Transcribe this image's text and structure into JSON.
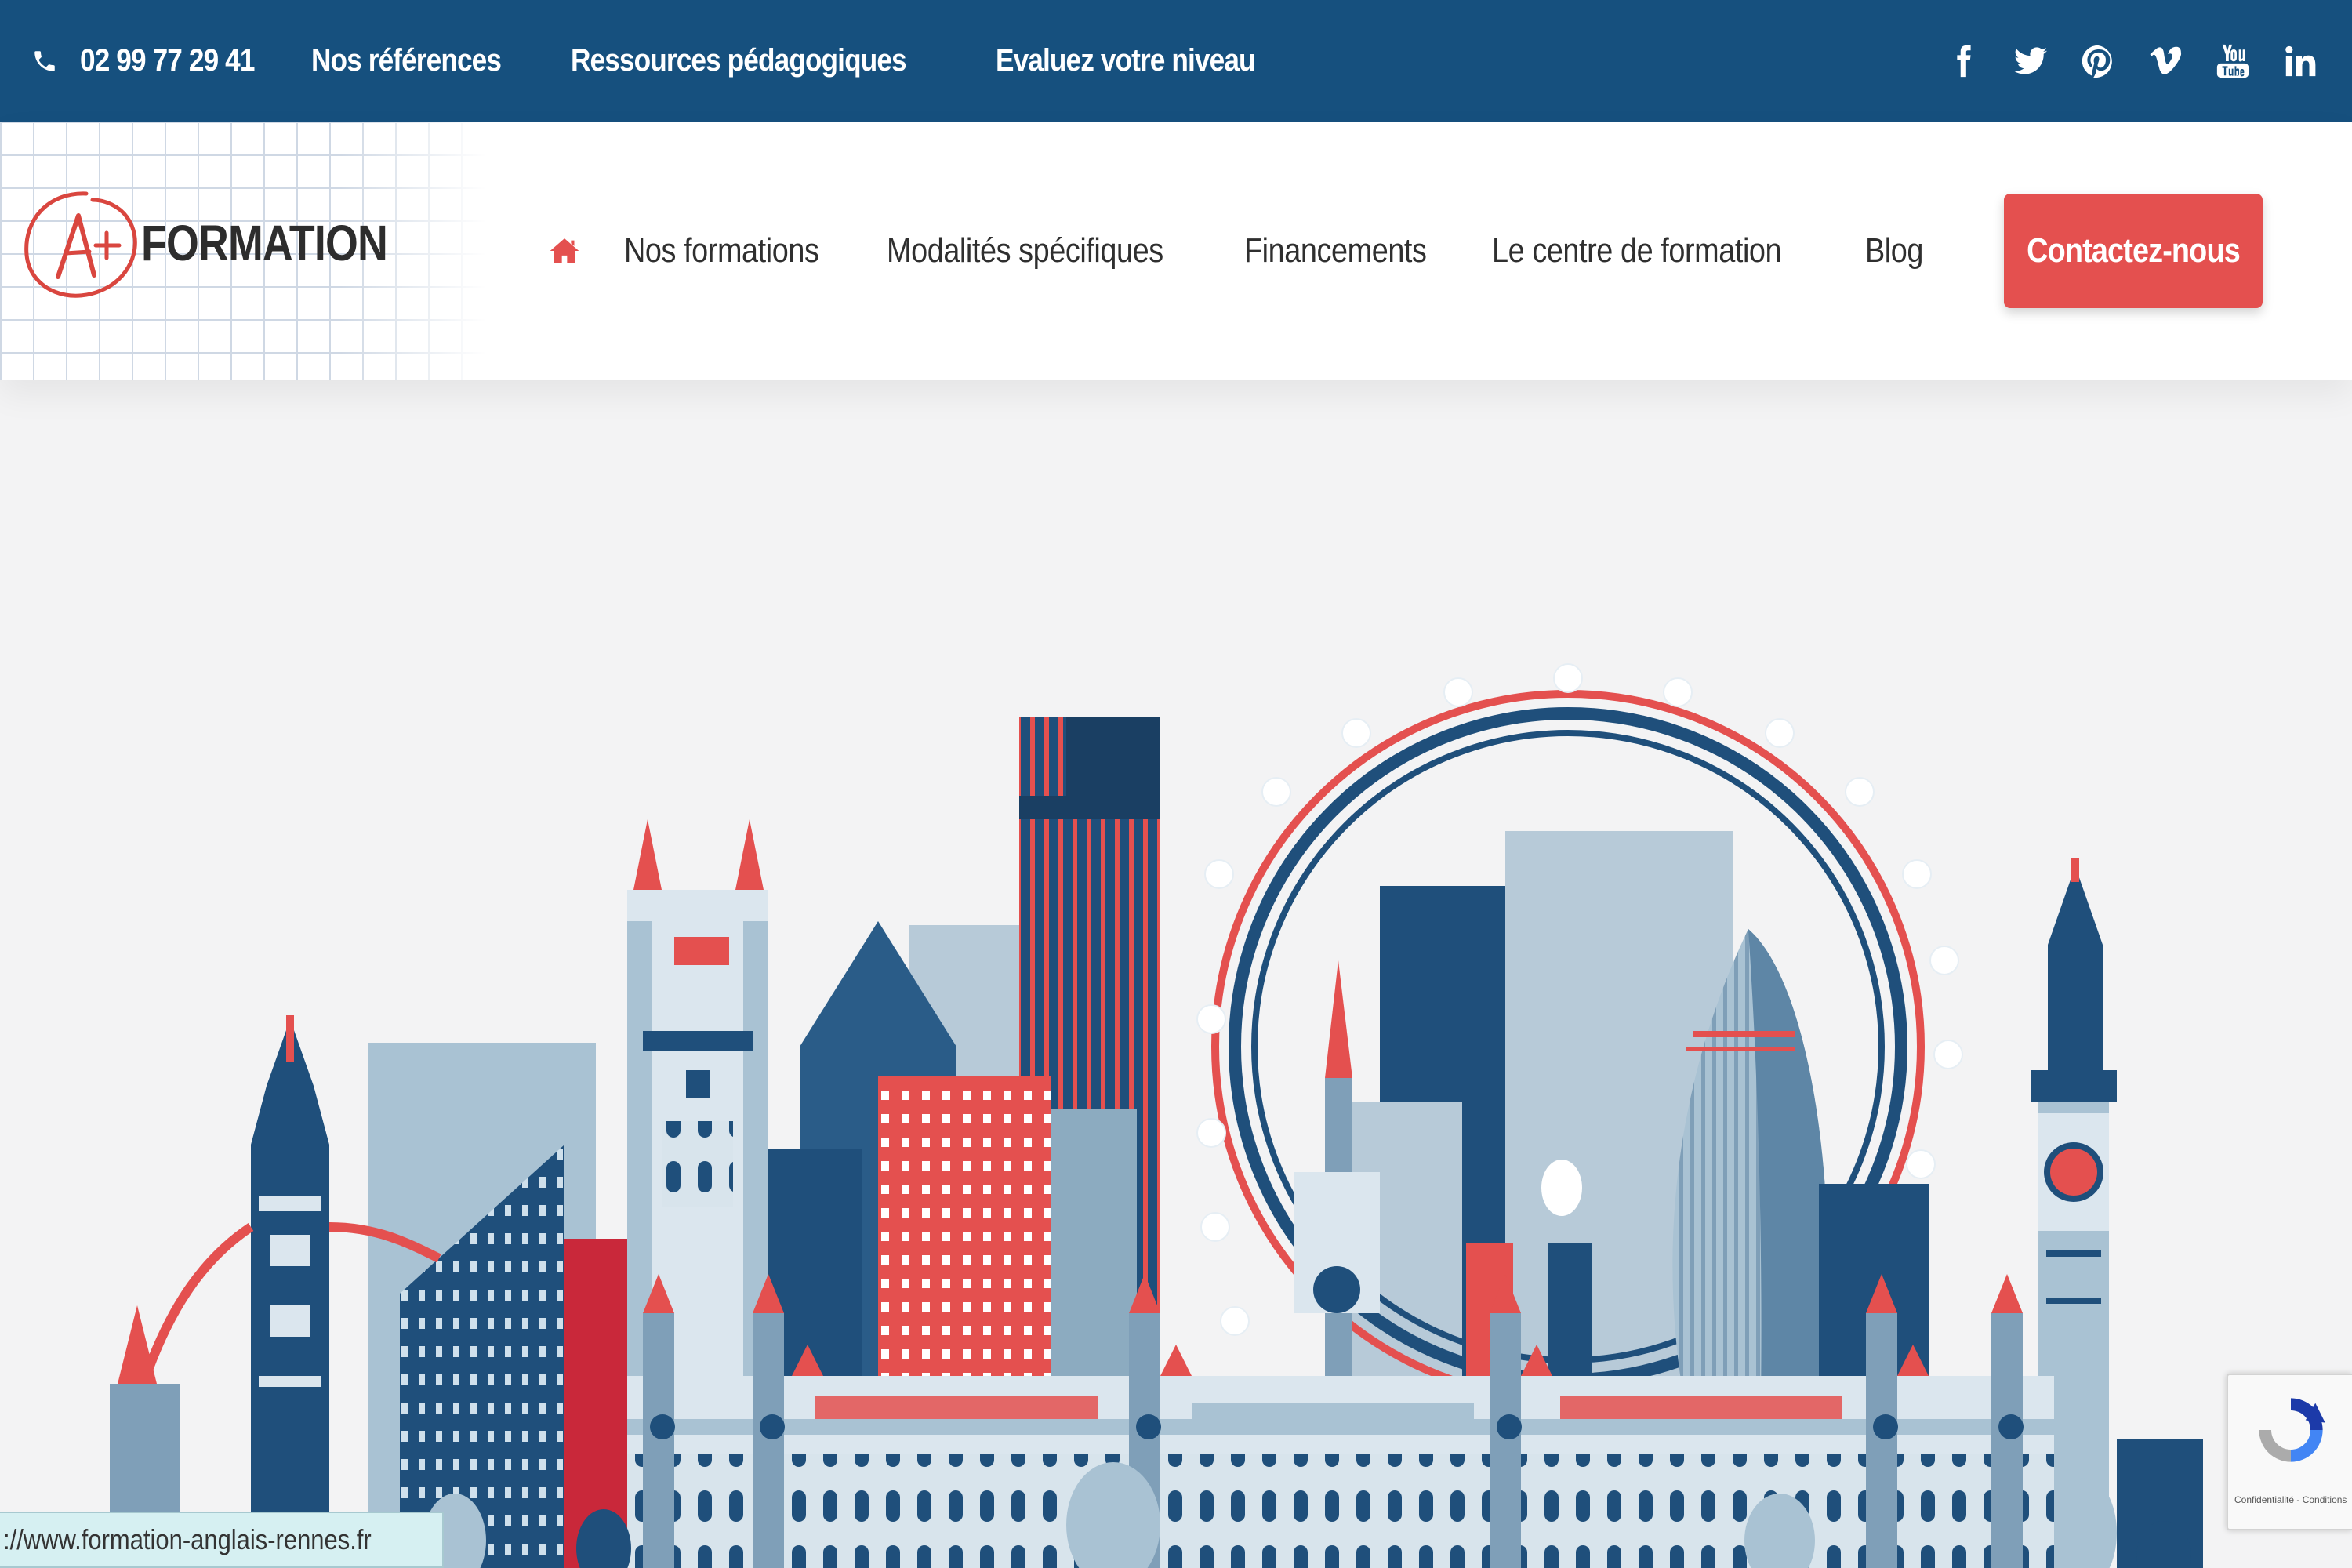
{
  "topbar": {
    "phone": "02 99 77 29 41",
    "links": [
      "Nos références",
      "Ressources pédagogiques",
      "Evaluez votre niveau"
    ],
    "social_icons": [
      "facebook-icon",
      "twitter-icon",
      "pinterest-icon",
      "vimeo-icon",
      "youtube-icon",
      "linkedin-icon"
    ]
  },
  "header": {
    "logo_mark": "A+",
    "logo_text": "FORMATION",
    "nav": [
      "Nos formations",
      "Modalités spécifiques",
      "Financements",
      "Le centre de formation",
      "Blog"
    ],
    "cta_label": "Contactez-nous"
  },
  "hero": {
    "illustration": "london-skyline-illustration"
  },
  "status_bar": {
    "url": "://www.formation-anglais-rennes.fr"
  },
  "recaptcha": {
    "legal": "Confidentialité - Conditions"
  },
  "colors": {
    "topbar": "#16507e",
    "accent_red": "#e4504f",
    "navy": "#1e4f7a",
    "light_blue": "#a9c2d3",
    "background": "#f3f3f4"
  }
}
